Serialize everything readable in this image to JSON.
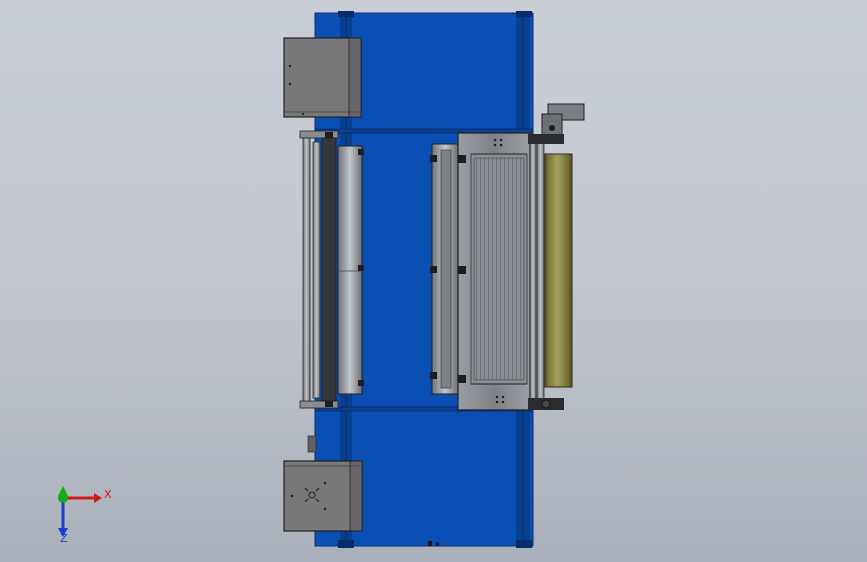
{
  "viewport": {
    "background_top": "#c9ced6",
    "background_bottom": "#aab0ba"
  },
  "colors": {
    "frame_blue": "#0a4fb4",
    "frame_blue_dark": "#073a88",
    "housing_gray": "#77777a",
    "roller_gray": "#8f9298",
    "roller_dark": "#333338",
    "roller_olive": "#7e7b3e",
    "outline": "#1f2126"
  },
  "triad": {
    "x_label": "X",
    "z_label": "Z",
    "x_color": "#d21a1a",
    "y_color": "#18a818",
    "z_color": "#1f3ccf"
  },
  "components": [
    {
      "name": "machine-frame",
      "icon": "blue-chassis"
    },
    {
      "name": "top-motor-housing",
      "icon": "gray-box"
    },
    {
      "name": "bottom-motor-housing",
      "icon": "gray-box-with-fan"
    },
    {
      "name": "left-roller-assembly",
      "icon": "cylinder-rollers"
    },
    {
      "name": "center-bracket-panel",
      "icon": "bracket"
    },
    {
      "name": "print-carriage",
      "icon": "carriage-frame"
    },
    {
      "name": "olive-coating-roller",
      "icon": "cylinder"
    },
    {
      "name": "right-drive-motor",
      "icon": "motor"
    }
  ]
}
